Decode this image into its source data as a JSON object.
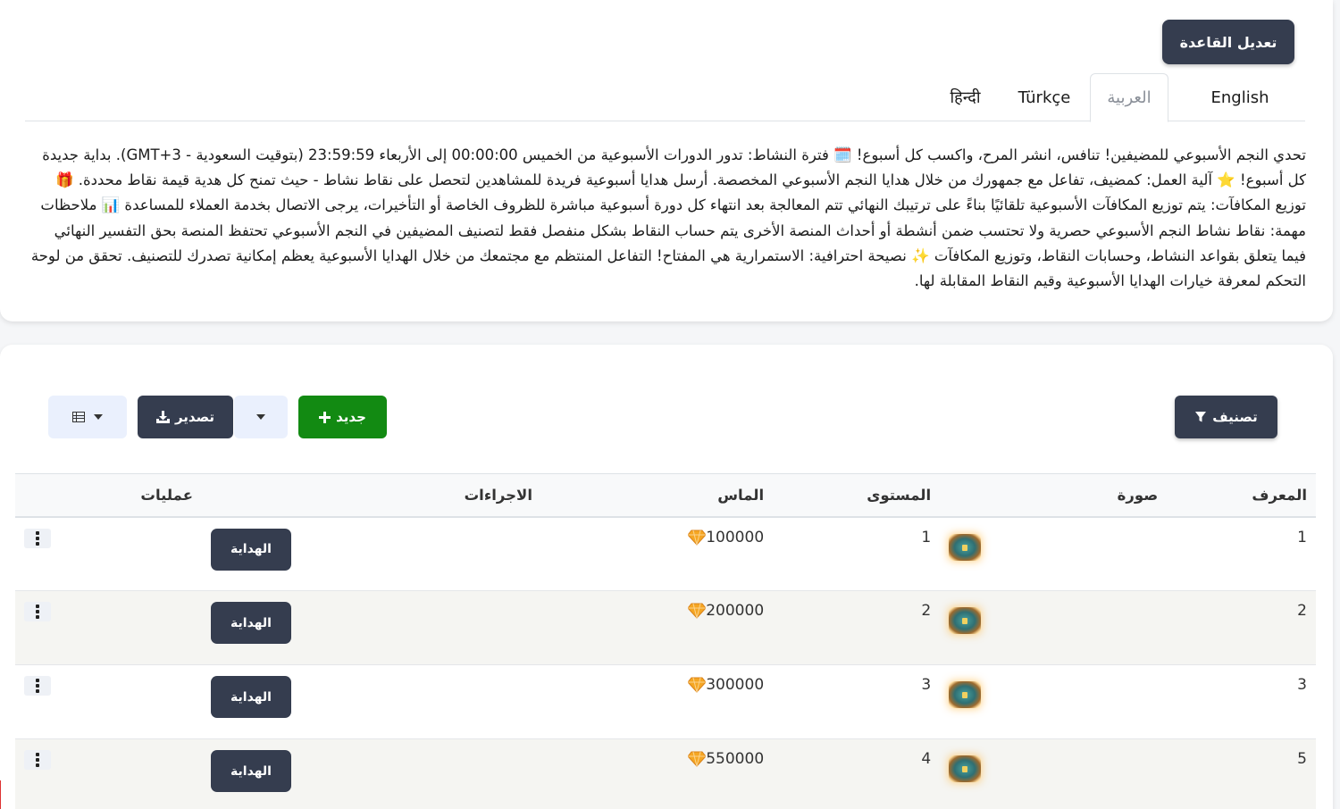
{
  "header": {
    "edit_rule_label": "تعديل القاعدة"
  },
  "tabs": [
    {
      "label": "English",
      "active": false
    },
    {
      "label": "العربية",
      "active": true
    },
    {
      "label": "Türkçe",
      "active": false
    },
    {
      "label": "हिन्दी",
      "active": false
    }
  ],
  "description": "تحدي النجم الأسبوعي للمضيفين! تنافس، انشر المرح، واكسب كل أسبوع! 🗓️ فترة النشاط: تدور الدورات الأسبوعية من الخميس 00:00:00 إلى الأربعاء 23:59:59 (بتوقيت السعودية - GMT+3). بداية جديدة كل أسبوع! ⭐ آلية العمل: كمضيف، تفاعل مع جمهورك من خلال هدايا النجم الأسبوعي المخصصة. أرسل هدايا أسبوعية فريدة للمشاهدين لتحصل على نقاط نشاط - حيث تمنح كل هدية قيمة نقاط محددة. 🎁 توزيع المكافآت: يتم توزيع المكافآت الأسبوعية تلقائيًا بناءً على ترتيبك النهائي تتم المعالجة بعد انتهاء كل دورة أسبوعية مباشرة للظروف الخاصة أو التأخيرات، يرجى الاتصال بخدمة العملاء للمساعدة 📊 ملاحظات مهمة: نقاط نشاط النجم الأسبوعي حصرية ولا تحتسب ضمن أنشطة أو أحداث المنصة الأخرى يتم حساب النقاط بشكل منفصل فقط لتصنيف المضيفين في النجم الأسبوعي تحتفظ المنصة بحق التفسير النهائي فيما يتعلق بقواعد النشاط، وحسابات النقاط، وتوزيع المكافآت ✨ نصيحة احترافية: الاستمرارية هي المفتاح! التفاعل المنتظم مع مجتمعك من خلال الهدايا الأسبوعية يعظم إمكانية تصدرك للتصنيف. تحقق من لوحة التحكم لمعرفة خيارات الهدايا الأسبوعية وقيم النقاط المقابلة لها.",
  "toolbar": {
    "filter_label": "تصنيف",
    "new_label": "جديد",
    "export_label": "تصدير",
    "colors": {
      "dark": "#353d4f",
      "green": "#128a12",
      "light": "#eaf0fd"
    }
  },
  "table": {
    "headers": {
      "id": "المعرف",
      "image": "صورة",
      "level": "المستوى",
      "diamond": "الماس",
      "actions": "الاجراءات",
      "operations": "عمليات"
    },
    "rows": [
      {
        "id": "1",
        "level": "1",
        "diamond": "100000",
        "action_label": "الهداية"
      },
      {
        "id": "2",
        "level": "2",
        "diamond": "200000",
        "action_label": "الهداية"
      },
      {
        "id": "3",
        "level": "3",
        "diamond": "300000",
        "action_label": "الهداية"
      },
      {
        "id": "5",
        "level": "4",
        "diamond": "550000",
        "action_label": "الهداية"
      }
    ]
  }
}
